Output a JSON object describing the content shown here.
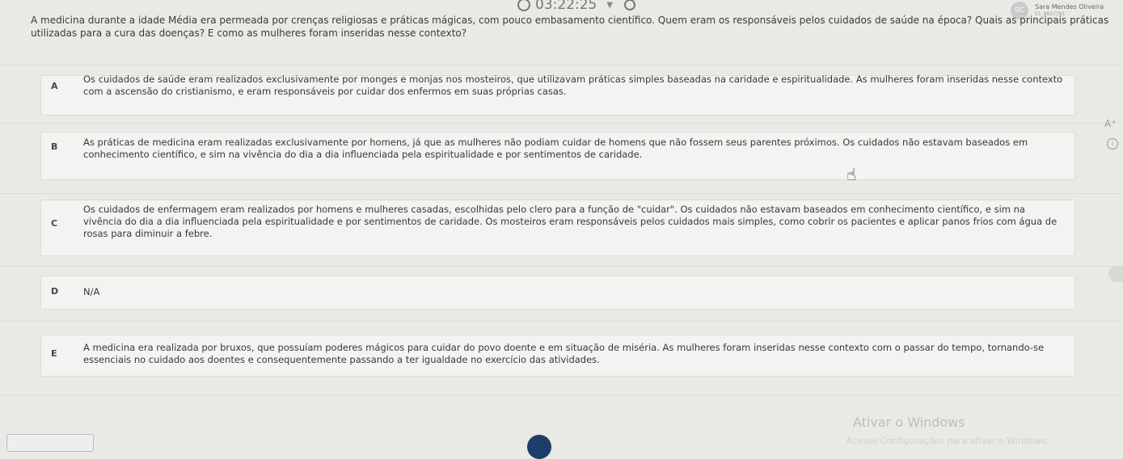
{
  "header": {
    "timer": "03:22:25",
    "user_initials": "SC",
    "user_name": "Sara Mendes Oliveira",
    "user_id": "51_8837791"
  },
  "question": "A medicina durante a idade Média era permeada por crenças religiosas e práticas mágicas, com pouco embasamento científico. Quem eram os responsáveis pelos cuidados de saúde na época? Quais as principais práticas utilizadas para a cura das doenças? E como as mulheres foram inseridas nesse contexto?",
  "options": [
    {
      "letter": "A",
      "text": "Os cuidados de saúde eram realizados exclusivamente por monges e monjas nos mosteiros, que utilizavam práticas simples baseadas na caridade e espiritualidade. As mulheres foram inseridas nesse contexto com a ascensão do cristianismo, e eram responsáveis por cuidar dos enfermos em suas próprias casas."
    },
    {
      "letter": "B",
      "text": "As práticas de medicina eram realizadas exclusivamente por homens, já que as mulheres não podiam cuidar de homens que não fossem seus parentes próximos. Os cuidados não estavam baseados em conhecimento científico, e sim na vivência do dia a dia influenciada pela espiritualidade e por sentimentos de caridade."
    },
    {
      "letter": "C",
      "text": "Os cuidados de enfermagem eram realizados por homens e mulheres casadas, escolhidas pelo clero para a função de \"cuidar\". Os cuidados não estavam baseados em conhecimento científico, e sim na vivência do dia a dia influenciada pela espiritualidade e por sentimentos de caridade. Os mosteiros eram responsáveis pelos cuidados mais simples, como cobrir os pacientes e aplicar panos frios com água de rosas para diminuir a febre."
    },
    {
      "letter": "D",
      "text": "N/A"
    },
    {
      "letter": "E",
      "text": "A medicina era realizada por bruxos, que possuíam poderes mágicos para cuidar do povo doente e em situação de miséria. As mulheres foram inseridas nesse contexto com o passar do tempo, tornando-se essenciais no cuidado aos doentes e consequentemente passando a ter igualdade no exercício das atividades."
    }
  ],
  "tools": {
    "font_increase": "A⁺",
    "info": "i"
  },
  "watermark": {
    "title": "Ativar o Windows",
    "subtitle": "Acesse Configurações para ativar o Windows."
  }
}
